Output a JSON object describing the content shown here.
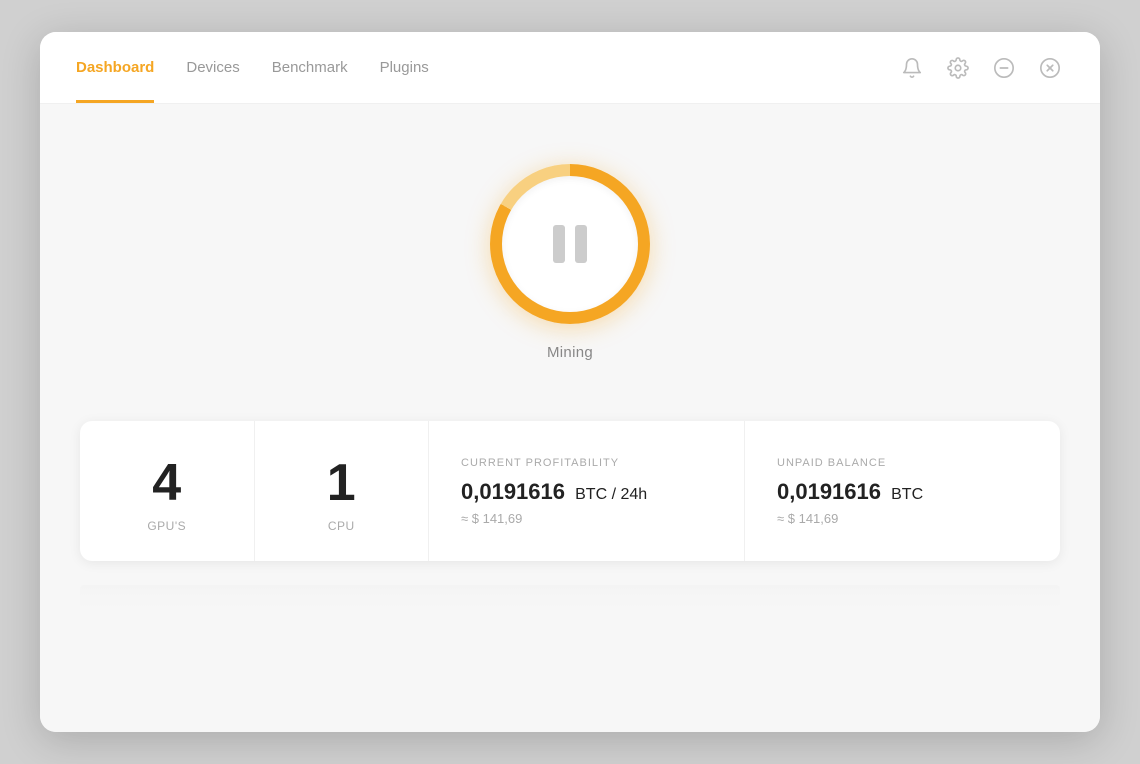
{
  "nav": {
    "tabs": [
      {
        "id": "dashboard",
        "label": "Dashboard",
        "active": true
      },
      {
        "id": "devices",
        "label": "Devices",
        "active": false
      },
      {
        "id": "benchmark",
        "label": "Benchmark",
        "active": false
      },
      {
        "id": "plugins",
        "label": "Plugins",
        "active": false
      }
    ]
  },
  "header_actions": {
    "bell_label": "Notifications",
    "settings_label": "Settings",
    "minimize_label": "Minimize",
    "close_label": "Close"
  },
  "mining": {
    "button_label": "Pause",
    "status_label": "Mining"
  },
  "stats": {
    "gpu_count": "4",
    "gpu_label": "GPU'S",
    "cpu_count": "1",
    "cpu_label": "CPU",
    "current_profitability": {
      "title": "CURRENT PROFITABILITY",
      "value": "0,0191616",
      "unit": "BTC / 24h",
      "approx": "≈ $ 141,69"
    },
    "unpaid_balance": {
      "title": "UNPAID BALANCE",
      "value": "0,0191616",
      "unit": "BTC",
      "approx": "≈ $ 141,69"
    }
  },
  "accent_color": "#f5a623"
}
